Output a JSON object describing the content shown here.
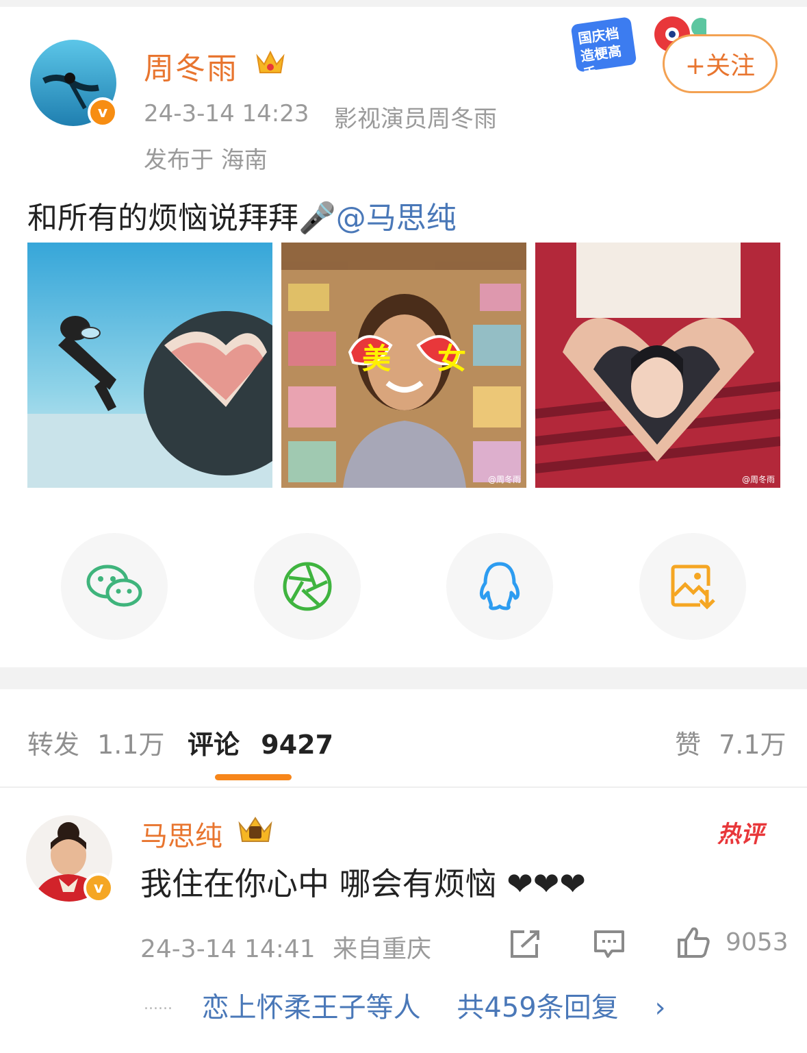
{
  "post": {
    "author": "周冬雨",
    "date_time": "24-3-14  14:23",
    "source": "影视演员周冬雨",
    "location": "发布于  海南",
    "text": "和所有的烦恼说拜拜🎤",
    "mention": "@马思纯",
    "follow_label": "+关注",
    "promo_badge": "国庆档造梗高手",
    "verified_mark": "v",
    "images": [
      {
        "icon": "photo-diver-heart-hands"
      },
      {
        "icon": "photo-smiling-woman-heart-glasses",
        "sticker_left": "美",
        "sticker_right": "女",
        "watermark": "@周冬雨"
      },
      {
        "icon": "photo-heart-hands-portrait",
        "watermark": "@周冬雨"
      }
    ]
  },
  "share": [
    {
      "icon": "wechat-icon",
      "color": "#3fb47c"
    },
    {
      "icon": "moments-icon",
      "color": "#3fb43f"
    },
    {
      "icon": "qq-icon",
      "color": "#2d9cf0"
    },
    {
      "icon": "save-image-icon",
      "color": "#f5a623"
    }
  ],
  "tabs": {
    "repost_label": "转发",
    "repost_count": "1.1万",
    "comment_label": "评论",
    "comment_count": "9427",
    "like_label": "赞",
    "like_count": "7.1万"
  },
  "comment": {
    "author": "马思纯",
    "text": "我住在你心中  哪会有烦恼 ❤❤❤",
    "date_time": "24-3-14  14:41",
    "location": "来自重庆",
    "like_count": "9053",
    "hot_badge": "热评",
    "replies_users": "恋上怀柔王子等人",
    "replies_count": "共459条回复",
    "replies_arrow": "›",
    "ellipsis": "······"
  },
  "colors": {
    "accent": "#e8752f",
    "link": "#4a78b8",
    "tab_underline": "#f7861a"
  }
}
